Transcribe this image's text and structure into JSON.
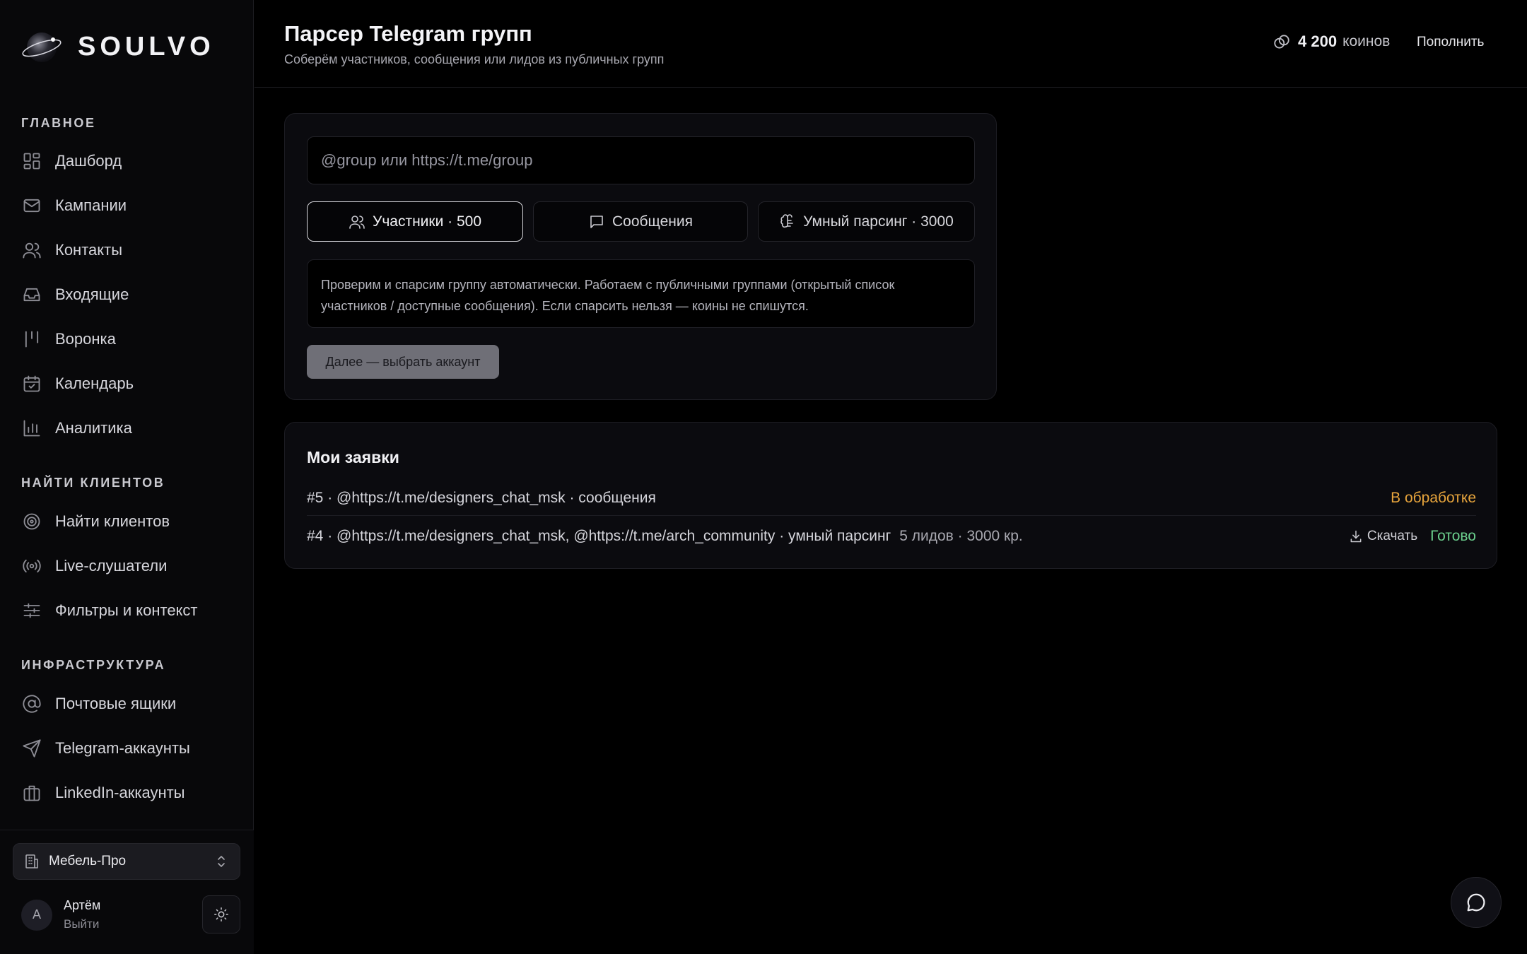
{
  "brand": {
    "name": "SOULVO"
  },
  "sidebar": {
    "sections": [
      {
        "title": "ГЛАВНОЕ",
        "items": [
          {
            "label": "Дашборд",
            "icon": "dashboard-icon"
          },
          {
            "label": "Кампании",
            "icon": "mail-icon"
          },
          {
            "label": "Контакты",
            "icon": "users-icon"
          },
          {
            "label": "Входящие",
            "icon": "inbox-icon"
          },
          {
            "label": "Воронка",
            "icon": "funnel-icon"
          },
          {
            "label": "Календарь",
            "icon": "calendar-icon"
          },
          {
            "label": "Аналитика",
            "icon": "chart-icon"
          }
        ]
      },
      {
        "title": "НАЙТИ КЛИЕНТОВ",
        "items": [
          {
            "label": "Найти клиентов",
            "icon": "target-icon"
          },
          {
            "label": "Live-слушатели",
            "icon": "broadcast-icon"
          },
          {
            "label": "Фильтры и контекст",
            "icon": "sliders-icon"
          }
        ]
      },
      {
        "title": "ИНФРАСТРУКТУРА",
        "items": [
          {
            "label": "Почтовые ящики",
            "icon": "at-icon"
          },
          {
            "label": "Telegram-аккаунты",
            "icon": "send-icon"
          },
          {
            "label": "LinkedIn-аккаунты",
            "icon": "briefcase-icon"
          }
        ]
      }
    ],
    "workspace": "Мебель-Про",
    "user": {
      "initial": "А",
      "name": "Артём",
      "logout": "Выйти"
    }
  },
  "header": {
    "title": "Парсер Telegram групп",
    "subtitle": "Соберём участников, сообщения или лидов из публичных групп",
    "coins_value": "4 200",
    "coins_unit": "коинов",
    "topup": "Пополнить"
  },
  "parser": {
    "input_placeholder": "@group или https://t.me/group",
    "input_value": "",
    "modes": [
      {
        "label": "Участники · 500",
        "icon": "users-icon",
        "active": true
      },
      {
        "label": "Сообщения",
        "icon": "message-icon",
        "active": false
      },
      {
        "label": "Умный парсинг · 3000",
        "icon": "brain-icon",
        "active": false
      }
    ],
    "info": "Проверим и спарсим группу автоматически. Работаем с публичными группами (открытый список участников / доступные сообщения). Если спарсить нельзя — коины не спишутся.",
    "next_button": "Далее — выбрать аккаунт"
  },
  "requests": {
    "title": "Мои заявки",
    "rows": [
      {
        "text": "#5 · @https://t.me/designers_chat_msk · сообщения",
        "meta": "",
        "download": "",
        "status": "В обработке",
        "status_kind": "processing"
      },
      {
        "text": "#4 · @https://t.me/designers_chat_msk, @https://t.me/arch_community · умный парсинг",
        "meta": "5 лидов · 3000 кр.",
        "download": "Скачать",
        "status": "Готово",
        "status_kind": "done"
      }
    ]
  },
  "colors": {
    "processing": "#e8a53c",
    "done": "#6bcf8d",
    "accent_button": "#6f6f77"
  }
}
